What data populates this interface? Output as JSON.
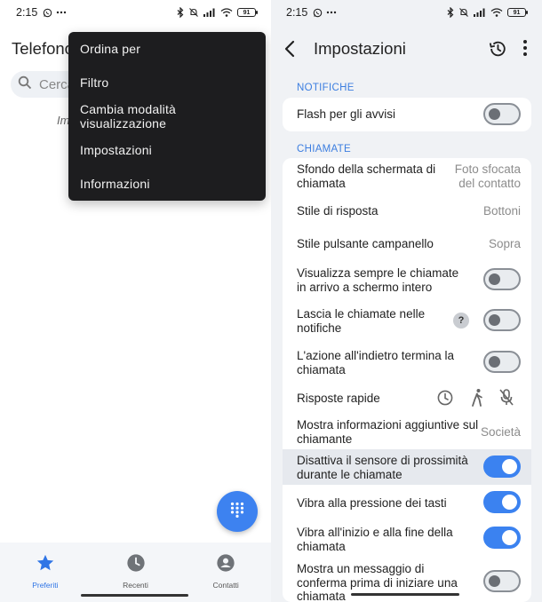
{
  "status_bar": {
    "time": "2:15",
    "battery": "91"
  },
  "left": {
    "title": "Telefono",
    "search_placeholder": "Cerca",
    "truncated_text": "Im",
    "menu": {
      "items": [
        {
          "label": "Ordina per"
        },
        {
          "label": "Filtro"
        },
        {
          "label": "Cambia modalità visualizzazione"
        },
        {
          "label": "Impostazioni"
        },
        {
          "label": "Informazioni"
        }
      ]
    },
    "bottom_nav": {
      "items": [
        {
          "label": "Preferiti",
          "icon": "star-icon",
          "active": true
        },
        {
          "label": "Recenti",
          "icon": "clock-icon",
          "active": false
        },
        {
          "label": "Contatti",
          "icon": "person-icon",
          "active": false
        }
      ]
    }
  },
  "right": {
    "title": "Impostazioni",
    "sections": {
      "notifiche": "NOTIFICHE",
      "chiamate": "CHIAMATE"
    },
    "settings": {
      "flash": {
        "label": "Flash per gli avvisi",
        "toggle": false
      },
      "sfondo": {
        "label": "Sfondo della schermata di chiamata",
        "value": "Foto sfocata del contatto"
      },
      "stile_risposta": {
        "label": "Stile di risposta",
        "value": "Bottoni"
      },
      "stile_campanello": {
        "label": "Stile pulsante campanello",
        "value": "Sopra"
      },
      "schermo_intero": {
        "label": "Visualizza sempre le chiamate in arrivo a schermo intero",
        "toggle": false
      },
      "lascia_notifiche": {
        "label": "Lascia le chiamate nelle notifiche",
        "help": "?",
        "toggle": false
      },
      "indietro": {
        "label": "L'azione all'indietro termina la chiamata",
        "toggle": false
      },
      "risposte_rapide": {
        "label": "Risposte rapide"
      },
      "info_aggiuntive": {
        "label": "Mostra informazioni aggiuntive sul chiamante",
        "value": "Società"
      },
      "sensore": {
        "label": "Disattiva il sensore di prossimità durante le chiamate",
        "toggle": true
      },
      "vibra_tasti": {
        "label": "Vibra alla pressione dei tasti",
        "toggle": true
      },
      "vibra_inizio": {
        "label": "Vibra all'inizio e alla fine della chiamata",
        "toggle": true
      },
      "conferma": {
        "label": "Mostra un messaggio di conferma prima di iniziare una chiamata",
        "toggle": false
      }
    }
  },
  "colors": {
    "accent": "#3b82f0",
    "section_label": "#3c7ee0",
    "menu_bg": "#1d1d1f",
    "panel_bg": "#f0f2f5"
  }
}
